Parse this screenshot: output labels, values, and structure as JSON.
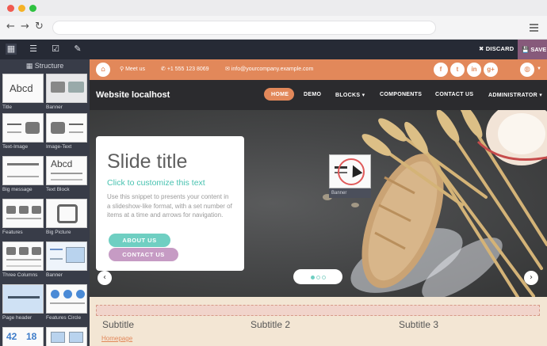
{
  "editor": {
    "discard_label": "✖ DISCARD",
    "save_label": "💾 SAVE"
  },
  "panel": {
    "heading": "Structure",
    "snippets": [
      {
        "label": "Title",
        "thumb_text": "Abcd"
      },
      {
        "label": "Banner"
      },
      {
        "label": "Text-Image"
      },
      {
        "label": "Image-Text"
      },
      {
        "label": "Big message"
      },
      {
        "label": "Text Block",
        "thumb_text": "Abcd"
      },
      {
        "label": "Features"
      },
      {
        "label": "Big Picture"
      },
      {
        "label": "Three Columns"
      },
      {
        "label": "Banner"
      },
      {
        "label": "Page header"
      },
      {
        "label": "Features Circle"
      },
      {
        "thumb_text": "42"
      },
      {
        "thumb_text": "18"
      }
    ]
  },
  "site": {
    "topbar": {
      "meet": "Meet us",
      "phone": "+1 555 123 8069",
      "email": "info@yourcompany.example.com",
      "social": [
        "f",
        "t",
        "in",
        "g+"
      ]
    },
    "brand": "Website localhost",
    "nav": [
      "HOME",
      "DEMO",
      "BLOCKS ▾",
      "COMPONENTS",
      "CONTACT US",
      "ADMINISTRATOR ▾"
    ],
    "slide": {
      "title": "Slide title",
      "subtitle": "Click to customize this text",
      "body": "Use this snippet to presents your content in a slideshow-like format, with a set number of items at a time and arrows for navigation.",
      "about": "ABOUT US",
      "contact": "CONTACT US"
    },
    "drag_label": "Banner",
    "subtitles": [
      "Subtitle",
      "Subtitle 2",
      "Subtitle 3"
    ],
    "homepage_link": "Homepage"
  }
}
